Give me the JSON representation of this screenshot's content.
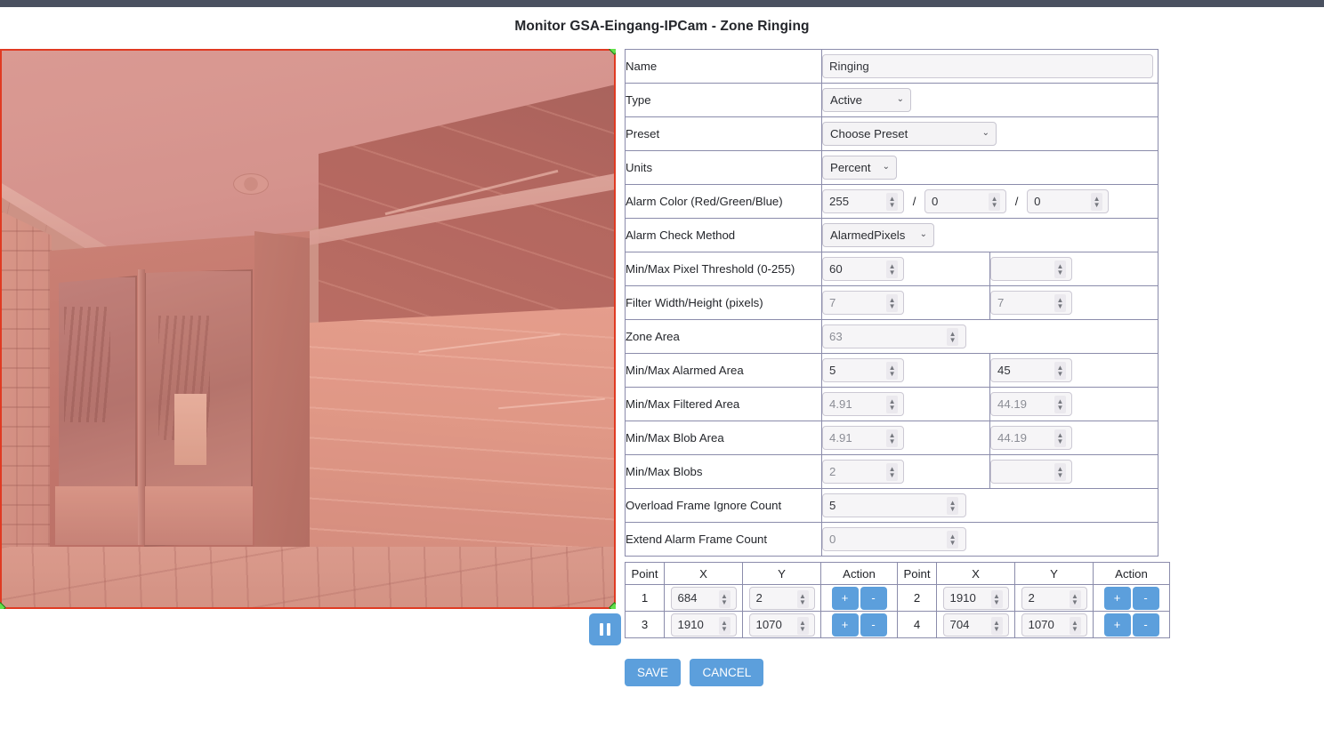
{
  "page": {
    "title": "Monitor GSA-Eingang-IPCam - Zone Ringing"
  },
  "video": {
    "pause_label": "",
    "zone_color": "#e03a22",
    "handle_color": "#62e04a",
    "tint_color": "rgba(225,60,45,0.20)"
  },
  "settings": {
    "rows": [
      {
        "label": "Name"
      },
      {
        "label": "Type"
      },
      {
        "label": "Preset"
      },
      {
        "label": "Units"
      },
      {
        "label": "Alarm Color (Red/Green/Blue)"
      },
      {
        "label": "Alarm Check Method"
      },
      {
        "label": "Min/Max Pixel Threshold (0-255)"
      },
      {
        "label": "Filter Width/Height (pixels)"
      },
      {
        "label": "Zone Area"
      },
      {
        "label": "Min/Max Alarmed Area"
      },
      {
        "label": "Min/Max Filtered Area"
      },
      {
        "label": "Min/Max Blob Area"
      },
      {
        "label": "Min/Max Blobs"
      },
      {
        "label": "Overload Frame Ignore Count"
      },
      {
        "label": "Extend Alarm Frame Count"
      }
    ],
    "values": {
      "name": "Ringing",
      "type": "Active",
      "preset": "Choose Preset",
      "units": "Percent",
      "alarm_color_red": "255",
      "alarm_color_green": "0",
      "alarm_color_blue": "0",
      "alarm_check_method": "AlarmedPixels",
      "pixel_threshold_min": "60",
      "pixel_threshold_max": "",
      "filter_width": "7",
      "filter_height": "7",
      "zone_area": "63",
      "alarmed_area_min": "5",
      "alarmed_area_max": "45",
      "filtered_area_min": "4.91",
      "filtered_area_max": "44.19",
      "blob_area_min": "4.91",
      "blob_area_max": "44.19",
      "blobs_min": "2",
      "blobs_max": "",
      "overload_frame_ignore_count": "5",
      "extend_alarm_frame_count": "0"
    },
    "separators": {
      "slash": "/"
    }
  },
  "points_table": {
    "headers": [
      "Point",
      "X",
      "Y",
      "Action"
    ],
    "add_label": "+",
    "remove_label": "-",
    "rows": [
      {
        "left": {
          "index": "1",
          "x": "684",
          "y": "2"
        },
        "right": {
          "index": "2",
          "x": "1910",
          "y": "2"
        }
      },
      {
        "left": {
          "index": "3",
          "x": "1910",
          "y": "1070"
        },
        "right": {
          "index": "4",
          "x": "704",
          "y": "1070"
        }
      }
    ]
  },
  "actions": {
    "save_label": "SAVE",
    "cancel_label": "CANCEL"
  }
}
